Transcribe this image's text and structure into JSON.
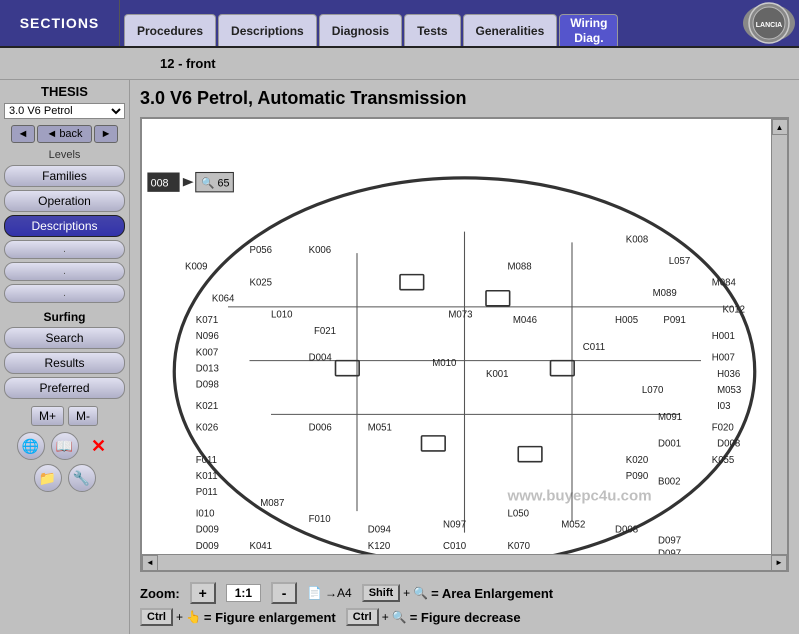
{
  "topnav": {
    "sections_label": "SECTIONS",
    "tabs": [
      {
        "id": "procedures",
        "label": "Procedures",
        "active": false
      },
      {
        "id": "descriptions",
        "label": "Descriptions",
        "active": false
      },
      {
        "id": "diagnosis",
        "label": "Diagnosis",
        "active": false
      },
      {
        "id": "tests",
        "label": "Tests",
        "active": false
      },
      {
        "id": "generalities",
        "label": "Generalities",
        "active": false
      }
    ],
    "wiring_tab": "Wiring\nDiag.",
    "logo_text": "LANCIA"
  },
  "subheader": {
    "text": "12 - front"
  },
  "sidebar": {
    "thesis": "THESIS",
    "vehicle": "3.0 V6 Petrol",
    "back_btn": "back",
    "levels_label": "Levels",
    "buttons": [
      {
        "label": "Families",
        "active": false
      },
      {
        "label": "Operation",
        "active": false
      },
      {
        "label": "Descriptions",
        "active": true
      },
      {
        "label": ".",
        "active": false
      },
      {
        "label": ".",
        "active": false
      },
      {
        "label": ".",
        "active": false
      }
    ],
    "surfing_label": "Surfing",
    "surfing_btns": [
      "Search",
      "Results",
      "Preferred"
    ],
    "mem_plus": "M+",
    "mem_minus": "M-"
  },
  "content": {
    "title": "3.0 V6 Petrol, Automatic Transmission",
    "zoom_label": "Zoom:",
    "zoom_ratio": "1:1",
    "zoom_plus": "+",
    "zoom_minus": "-",
    "a4_label": "→A4",
    "shift_label": "Shift",
    "area_enlargement": "= Area Enlargement",
    "ctrl_label": "Ctrl",
    "figure_enlargement": "= Figure enlargement",
    "figure_decrease": "= Figure decrease",
    "watermark": "www.buyepc4u.com"
  }
}
